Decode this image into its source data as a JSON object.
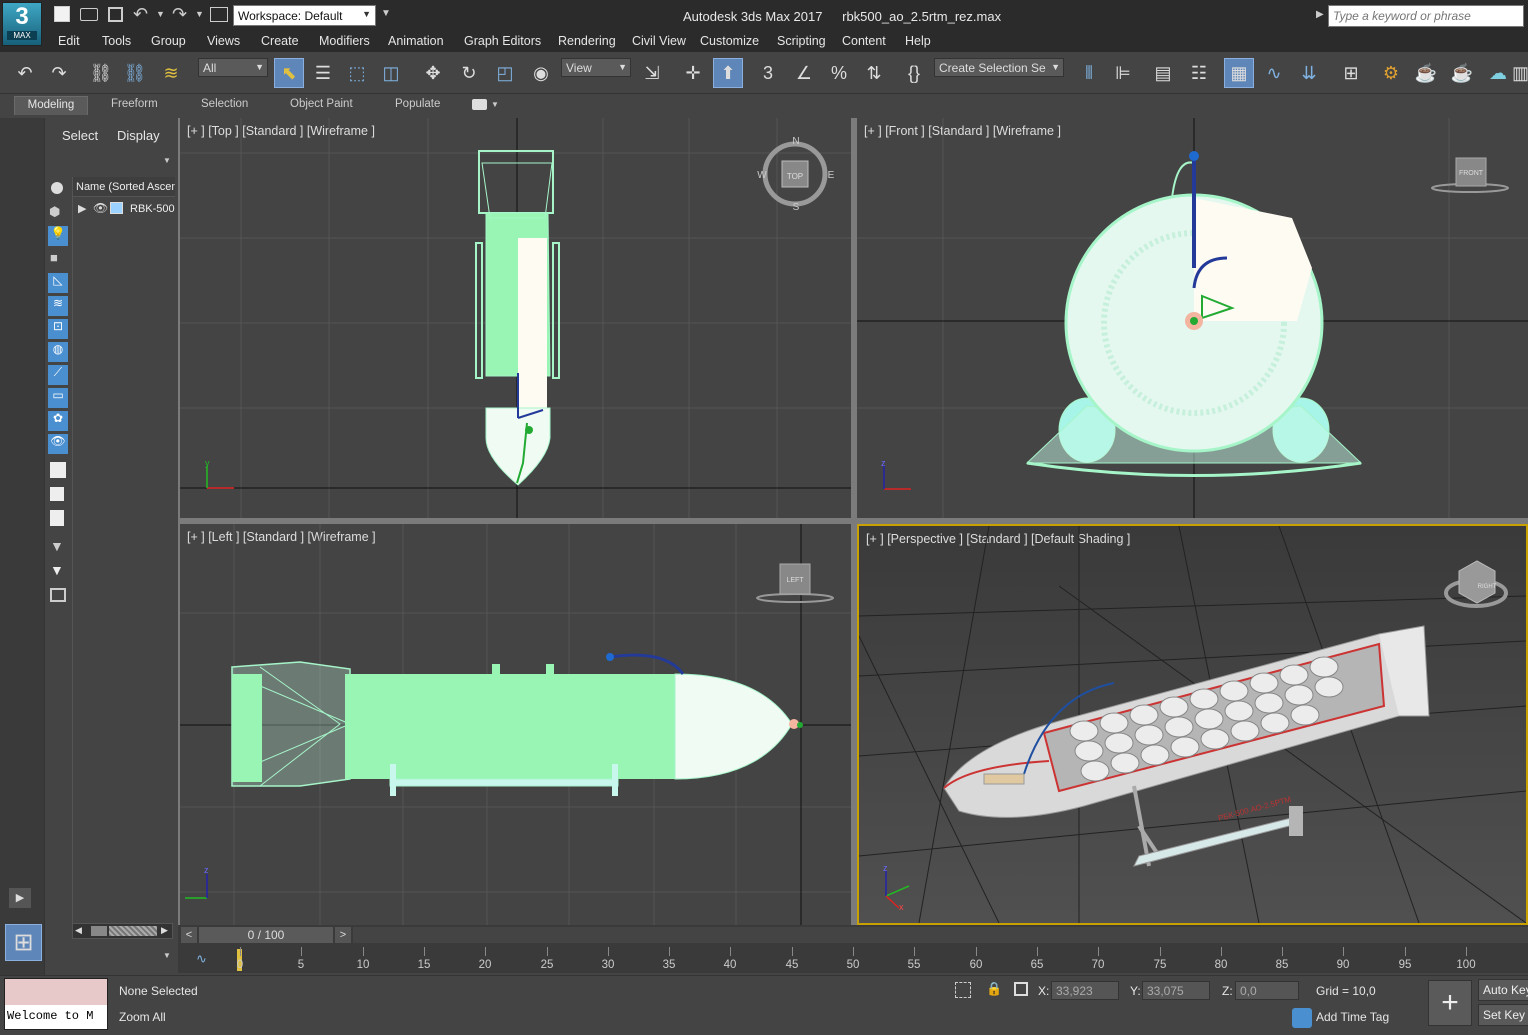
{
  "app": {
    "logo_top": "3",
    "logo_bottom": "MAX",
    "title": "Autodesk 3ds Max 2017",
    "file": "rbk500_ao_2.5rtm_rez.max"
  },
  "quickaccess": {
    "workspace": "Workspace: Default"
  },
  "search": {
    "placeholder": "Type a keyword or phrase"
  },
  "menu": [
    "Edit",
    "Tools",
    "Group",
    "Views",
    "Create",
    "Modifiers",
    "Animation",
    "Graph Editors",
    "Rendering",
    "Civil View",
    "Customize",
    "Scripting",
    "Content",
    "Help"
  ],
  "toolbar": {
    "filter": "All",
    "refcoord": "View",
    "selset": "Create Selection Se"
  },
  "ribbon": {
    "tabs": [
      "Modeling",
      "Freeform",
      "Selection",
      "Object Paint",
      "Populate"
    ]
  },
  "scene": {
    "tab_select": "Select",
    "tab_display": "Display",
    "column": "Name (Sorted Ascen",
    "item": "RBK-500"
  },
  "viewports": {
    "top": {
      "label": "[+ ] [Top ] [Standard ] [Wireframe ]",
      "cube": "TOP",
      "compass": [
        "N",
        "E",
        "S",
        "W"
      ]
    },
    "front": {
      "label": "[+ ] [Front ] [Standard ] [Wireframe ]",
      "cube": "FRONT"
    },
    "left": {
      "label": "[+ ] [Left ] [Standard ] [Wireframe ]",
      "cube": "LEFT"
    },
    "persp": {
      "label": "[+ ] [Perspective ] [Standard ] [Default Shading ]",
      "cube": "RIGHT",
      "decal": "РБК-500 АО-2.5РТМ"
    },
    "axes": {
      "x": "x",
      "y": "y",
      "z": "z"
    }
  },
  "timeline": {
    "frame": "0 / 100",
    "ticks": [
      "0",
      "5",
      "10",
      "15",
      "20",
      "25",
      "30",
      "35",
      "40",
      "45",
      "50",
      "55",
      "60",
      "65",
      "70",
      "75",
      "80",
      "85",
      "90",
      "95",
      "100"
    ]
  },
  "status": {
    "maxscript": "Welcome to M",
    "selected": "None Selected",
    "prompt": "Zoom All",
    "x_label": "X:",
    "x_value": "33,923",
    "y_label": "Y:",
    "y_value": "33,075",
    "z_label": "Z:",
    "z_value": "0,0",
    "grid": "Grid = 10,0",
    "add_time_tag": "Add Time Tag",
    "auto_key": "Auto Key",
    "set_key": "Set Key"
  },
  "colors": {
    "accent": "#4a90d9",
    "wire": "#a6f5c9",
    "bg": "#444444",
    "active_border": "#c8a000"
  }
}
